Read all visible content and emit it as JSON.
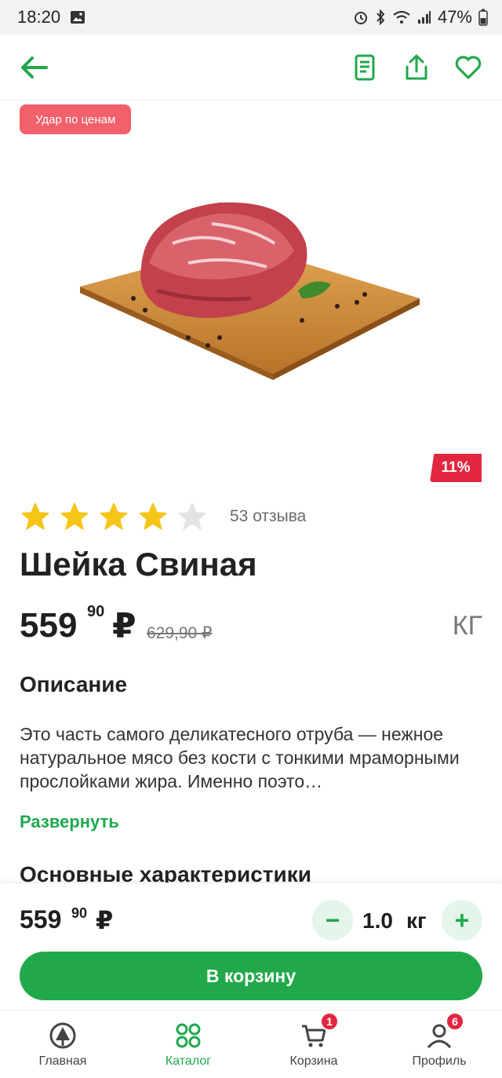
{
  "status_bar": {
    "time": "18:20",
    "battery": "47%"
  },
  "colors": {
    "accent": "#21a84a",
    "promo_badge": "#f2606b",
    "discount_badge": "#e32640",
    "star_filled": "#f5c518",
    "star_empty": "#e3e3e3"
  },
  "top_nav": {
    "back_icon": "arrow-left-icon",
    "actions": [
      "receipt-icon",
      "share-icon",
      "heart-icon"
    ]
  },
  "product": {
    "promo_label": "Удар по ценам",
    "discount": "11%",
    "rating": {
      "stars_filled": 4,
      "stars_total": 5,
      "reviews": "53 отзыва"
    },
    "title": "Шейка Свиная",
    "price": {
      "main": "559",
      "kop": "90",
      "currency": "₽",
      "old": "629,90 ₽"
    },
    "unit": "КГ",
    "description_title": "Описание",
    "description": "Это часть самого деликатесного отруба — нежное натуральное мясо без кости с тонкими мраморными прослойками жира. Именно поэто…",
    "expand_label": "Развернуть",
    "specs_title": "Основные характеристики"
  },
  "buy_panel": {
    "price_main": "559",
    "price_kop": "90",
    "currency": "₽",
    "quantity": "1.0",
    "quantity_unit": "кг",
    "minus": "−",
    "plus": "+",
    "cart_button": "В корзину"
  },
  "bottom_nav": [
    {
      "label": "Главная",
      "icon": "home-logo-icon"
    },
    {
      "label": "Каталог",
      "icon": "catalog-grid-icon",
      "active": true
    },
    {
      "label": "Корзина",
      "icon": "cart-icon",
      "badge": "1"
    },
    {
      "label": "Профиль",
      "icon": "profile-icon",
      "badge": "6"
    }
  ]
}
